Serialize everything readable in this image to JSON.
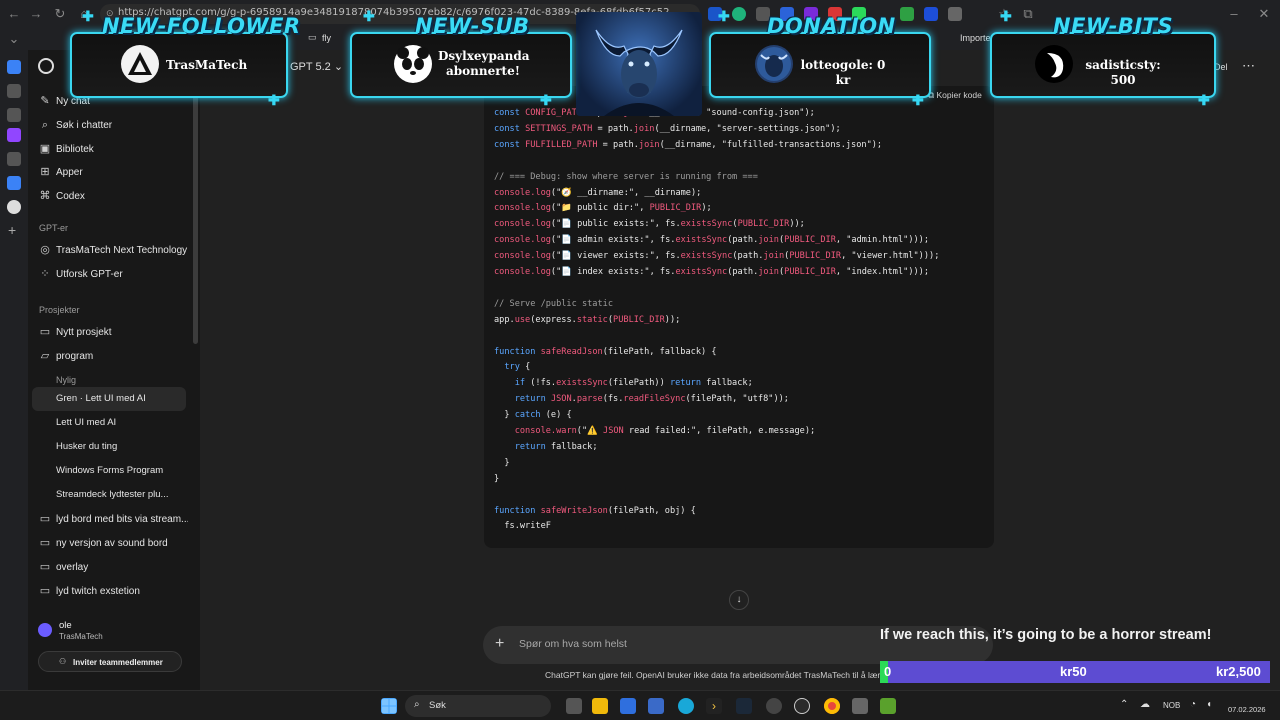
{
  "browser": {
    "url": "https://chatgpt.com/g/g-p-6958914a9e348191878074b39507eb82/c/6976f023-47dc-8389-8efa-68fdb6f57c52",
    "bookmarks": [
      "fly",
      "Importe"
    ]
  },
  "app": {
    "model_label": "GPT 5.2",
    "share_label": "Del",
    "copy_code_label": "Kopier kode"
  },
  "sidebar": {
    "nav": [
      {
        "label": "Ny chat",
        "icon": "new-chat-icon"
      },
      {
        "label": "Søk i chatter",
        "icon": "search-icon"
      },
      {
        "label": "Bibliotek",
        "icon": "library-icon"
      },
      {
        "label": "Apper",
        "icon": "apps-icon"
      },
      {
        "label": "Codex",
        "icon": "codex-icon"
      }
    ],
    "gpts_heading": "GPT-er",
    "gpts": [
      {
        "label": "TrasMaTech Next Technology",
        "icon": "gpt-icon"
      },
      {
        "label": "Utforsk GPT-er",
        "icon": "explore-icon"
      }
    ],
    "projects_heading": "Prosjekter",
    "projects": [
      {
        "label": "Nytt prosjekt",
        "icon": "new-folder-icon"
      },
      {
        "label": "program",
        "icon": "folder-open-icon"
      }
    ],
    "recent_heading": "Nylig",
    "recent": [
      "Gren · Lett UI med AI",
      "Lett UI med AI",
      "Husker du ting",
      "Windows Forms Program",
      "Streamdeck lydtester plu..."
    ],
    "more_projects": [
      "lyd bord med bits via stream...",
      "ny versjon av sound bord",
      "overlay",
      "lyd twitch exstetion"
    ],
    "user": {
      "name": "ole",
      "org": "TrasMaTech"
    },
    "invite_label": "Inviter teammedlemmer"
  },
  "code": {
    "lines": [
      "const CONFIG_PATH = path.join(__dirname, \"sound-config.json\");",
      "const SETTINGS_PATH = path.join(__dirname, \"server-settings.json\");",
      "const FULFILLED_PATH = path.join(__dirname, \"fulfilled-transactions.json\");",
      "",
      "// === Debug: show where server is running from ===",
      "console.log(\"🧭 __dirname:\", __dirname);",
      "console.log(\"📁 public dir:\", PUBLIC_DIR);",
      "console.log(\"📄 public exists:\", fs.existsSync(PUBLIC_DIR));",
      "console.log(\"📄 admin exists:\", fs.existsSync(path.join(PUBLIC_DIR, \"admin.html\")));",
      "console.log(\"📄 viewer exists:\", fs.existsSync(path.join(PUBLIC_DIR, \"viewer.html\")));",
      "console.log(\"📄 index exists:\", fs.existsSync(path.join(PUBLIC_DIR, \"index.html\")));",
      "",
      "// Serve /public static",
      "app.use(express.static(PUBLIC_DIR));",
      "",
      "function safeReadJson(filePath, fallback) {",
      "  try {",
      "    if (!fs.existsSync(filePath)) return fallback;",
      "    return JSON.parse(fs.readFileSync(filePath, \"utf8\"));",
      "  } catch (e) {",
      "    console.warn(\"⚠️ JSON read failed:\", filePath, e.message);",
      "    return fallback;",
      "  }",
      "}",
      "",
      "function safeWriteJson(filePath, obj) {",
      "  fs.writeF"
    ]
  },
  "composer": {
    "placeholder": "Spør om hva som helst",
    "disclaimer": "ChatGPT kan gjøre feil. OpenAI bruker ikke data fra arbeidsområdet TrasMaTech til å lære opp m"
  },
  "alerts": [
    {
      "title": "NEW-FOLLOWER",
      "label": "TrasMaTech",
      "icon": "follower-avatar-icon"
    },
    {
      "title": "NEW-SUB",
      "label": "Dsylxeypanda abonnerte!",
      "icon": "panda-avatar-icon"
    },
    {
      "title": "DONATION",
      "label": "lotteogole: 0 kr",
      "icon": "donation-avatar-icon"
    },
    {
      "title": "NEW-BITS",
      "label": "sadisticsty: 500",
      "icon": "bits-avatar-icon"
    }
  ],
  "goal": {
    "title": "If we reach this, it’s going to be a horror stream!",
    "current": "0",
    "mid": "kr50",
    "target": "kr2,500",
    "progress": 0.02,
    "colors": {
      "fill": "#2bd957",
      "track": "#5d4cd2"
    }
  },
  "taskbar": {
    "search_label": "Søk",
    "lang": "NOB",
    "date": "07.02.2026"
  }
}
